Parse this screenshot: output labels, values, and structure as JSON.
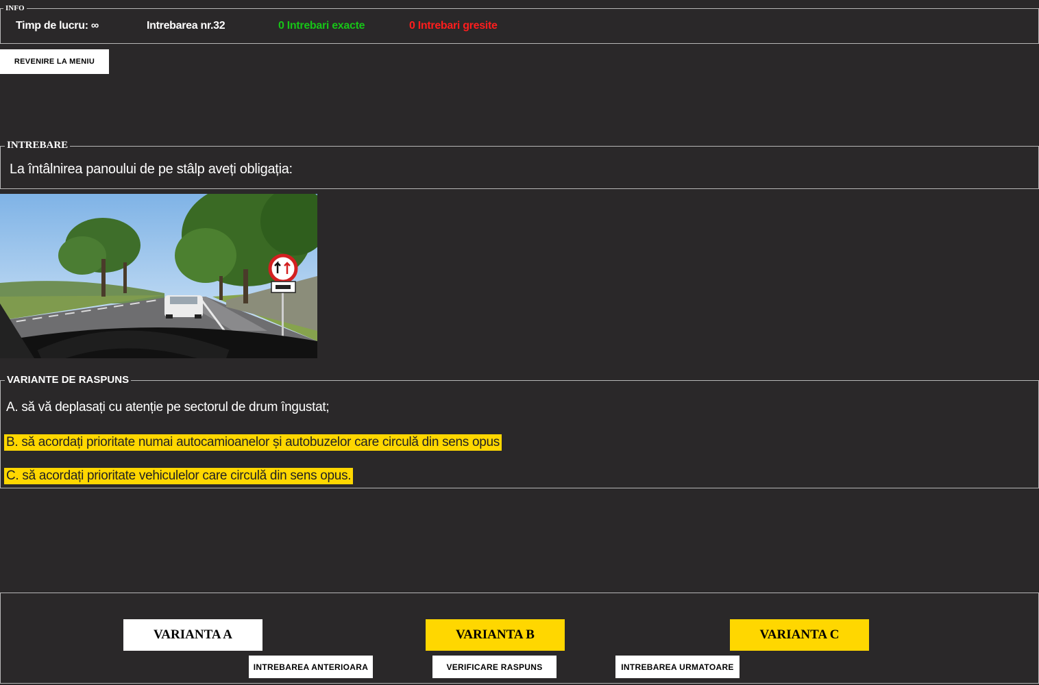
{
  "info": {
    "legend": "INFO",
    "timp": "Timp de lucru: ∞",
    "intrebare_nr": "Intrebarea nr.32",
    "exacte": "0 Intrebari exacte",
    "gresite": "0 Intrebari gresite"
  },
  "menu_button": "REVENIRE LA MENIU",
  "question": {
    "legend": "INTREBARE",
    "text": "La întâlnirea panoului de pe stâlp aveți obligația:"
  },
  "answers": {
    "legend": "VARIANTE DE RASPUNS",
    "options": [
      {
        "text": "A. să vă deplasați cu atenție pe sectorul de drum îngustat;",
        "selected": false
      },
      {
        "text": "B. să acordați prioritate numai autocamioanelor și autobuzelor care circulă din sens opus",
        "selected": true
      },
      {
        "text": "C. să acordați prioritate vehiculelor care circulă din sens opus.",
        "selected": true
      }
    ]
  },
  "controls": {
    "varianta_a": "VARIANTA A",
    "varianta_b": "VARIANTA B",
    "varianta_c": "VARIANTA C",
    "anterioara": "INTREBAREA ANTERIOARA",
    "verificare": "VERIFICARE RASPUNS",
    "urmatoare": "INTREBAREA URMATOARE"
  },
  "colors": {
    "background": "#2a2829",
    "selected": "#ffd700",
    "correct": "#17c417",
    "wrong": "#ff1d1d"
  }
}
